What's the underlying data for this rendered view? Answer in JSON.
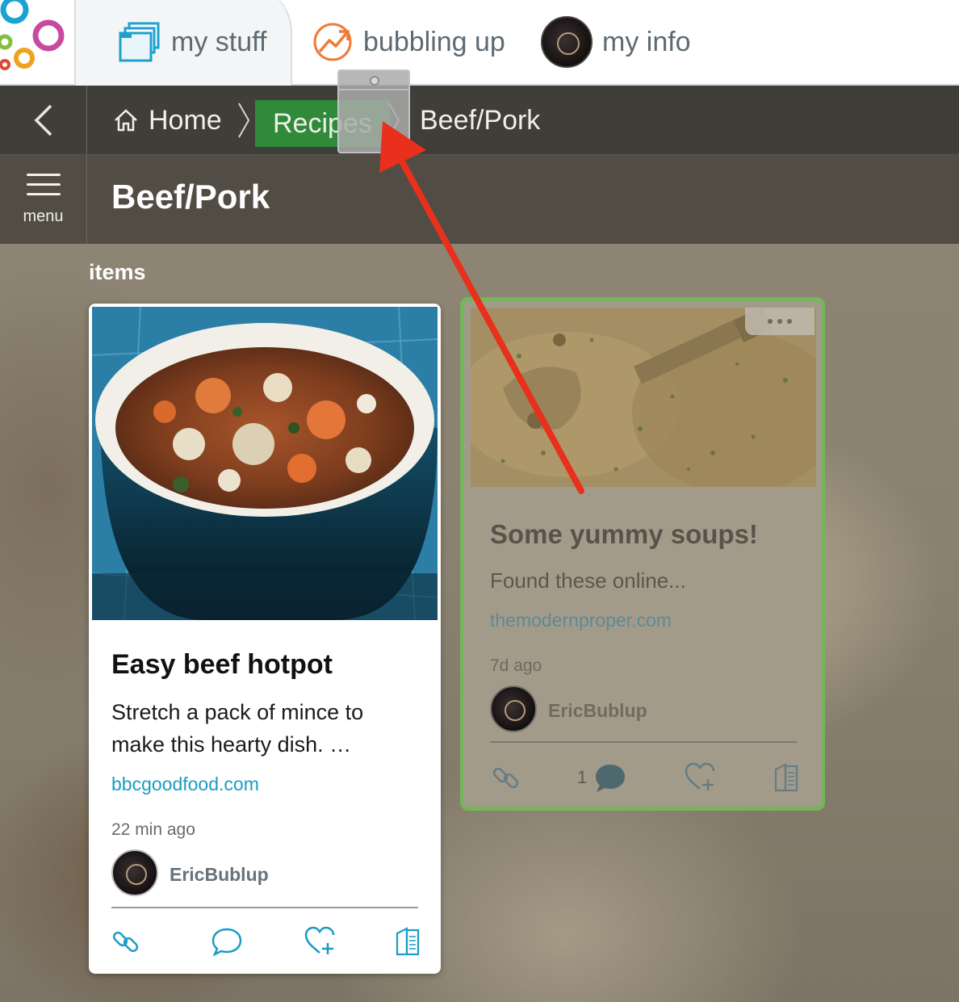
{
  "topnav": {
    "tabs": [
      {
        "label": "my stuff",
        "icon": "folders-icon"
      },
      {
        "label": "bubbling up",
        "icon": "trending-up-icon"
      },
      {
        "label": "my info",
        "icon": "avatar"
      }
    ]
  },
  "breadcrumb": {
    "home": "Home",
    "recipes": "Recipes",
    "current": "Beef/Pork"
  },
  "titlebar": {
    "menu_label": "menu",
    "title": "Beef/Pork"
  },
  "section_label": "items",
  "cards": [
    {
      "title": "Easy beef hotpot",
      "description": "Stretch a pack of mince to make this hearty dish. …",
      "source": "bbcgoodfood.com",
      "time": "22 min ago",
      "user": "EricBublup",
      "comment_count": ""
    },
    {
      "title": "Some yummy soups!",
      "description": "Found these online...",
      "source": "themodernproper.com",
      "time": "7d ago",
      "user": "EricBublup",
      "comment_count": "1"
    }
  ],
  "colors": {
    "accent_blue": "#1a9cc4",
    "breadcrumb_active": "#2f8a3a",
    "drop_target_border": "#76b65a",
    "annotation_arrow": "#e8301c"
  }
}
